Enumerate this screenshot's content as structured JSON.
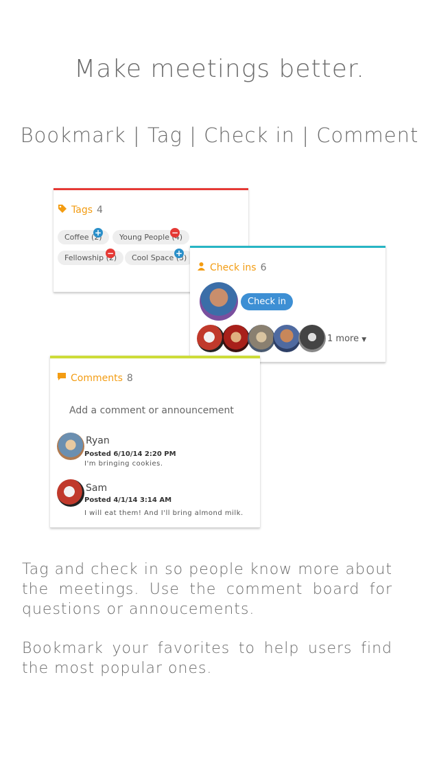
{
  "headline": "Make meetings better.",
  "subline": "Bookmark | Tag | Check in | Comment",
  "tags_card": {
    "title": "Tags",
    "count": "4",
    "accent": "#e53935",
    "tags": [
      {
        "label": "Coffee (2)",
        "action": "add"
      },
      {
        "label": "Young People (4)",
        "action": "remove"
      },
      {
        "label": "Fellowship (2)",
        "action": "remove"
      },
      {
        "label": "Cool Space (3)",
        "action": "add"
      }
    ]
  },
  "checkins_card": {
    "title": "Check ins",
    "count": "6",
    "accent": "#26b5c4",
    "button": "Check in",
    "more": "1 more"
  },
  "comments_card": {
    "title": "Comments",
    "count": "8",
    "accent": "#cddc39",
    "placeholder": "Add a comment or announcement",
    "comments": [
      {
        "name": "Ryan",
        "date": "Posted 6/10/14 2:20 PM",
        "text": "I'm bringing cookies."
      },
      {
        "name": "Sam",
        "date": "Posted 4/1/14 3:14 AM",
        "text": "I will eat them! And I'll bring almond milk."
      }
    ]
  },
  "paragraphs": [
    "Tag and check in so people know more about the meetings. Use the comment board for questions or annoucements.",
    "Bookmark your favorites to help users find the most popular ones."
  ],
  "colors": {
    "add": "#2a8fc9",
    "remove": "#e53935",
    "title": "#f39c12"
  }
}
